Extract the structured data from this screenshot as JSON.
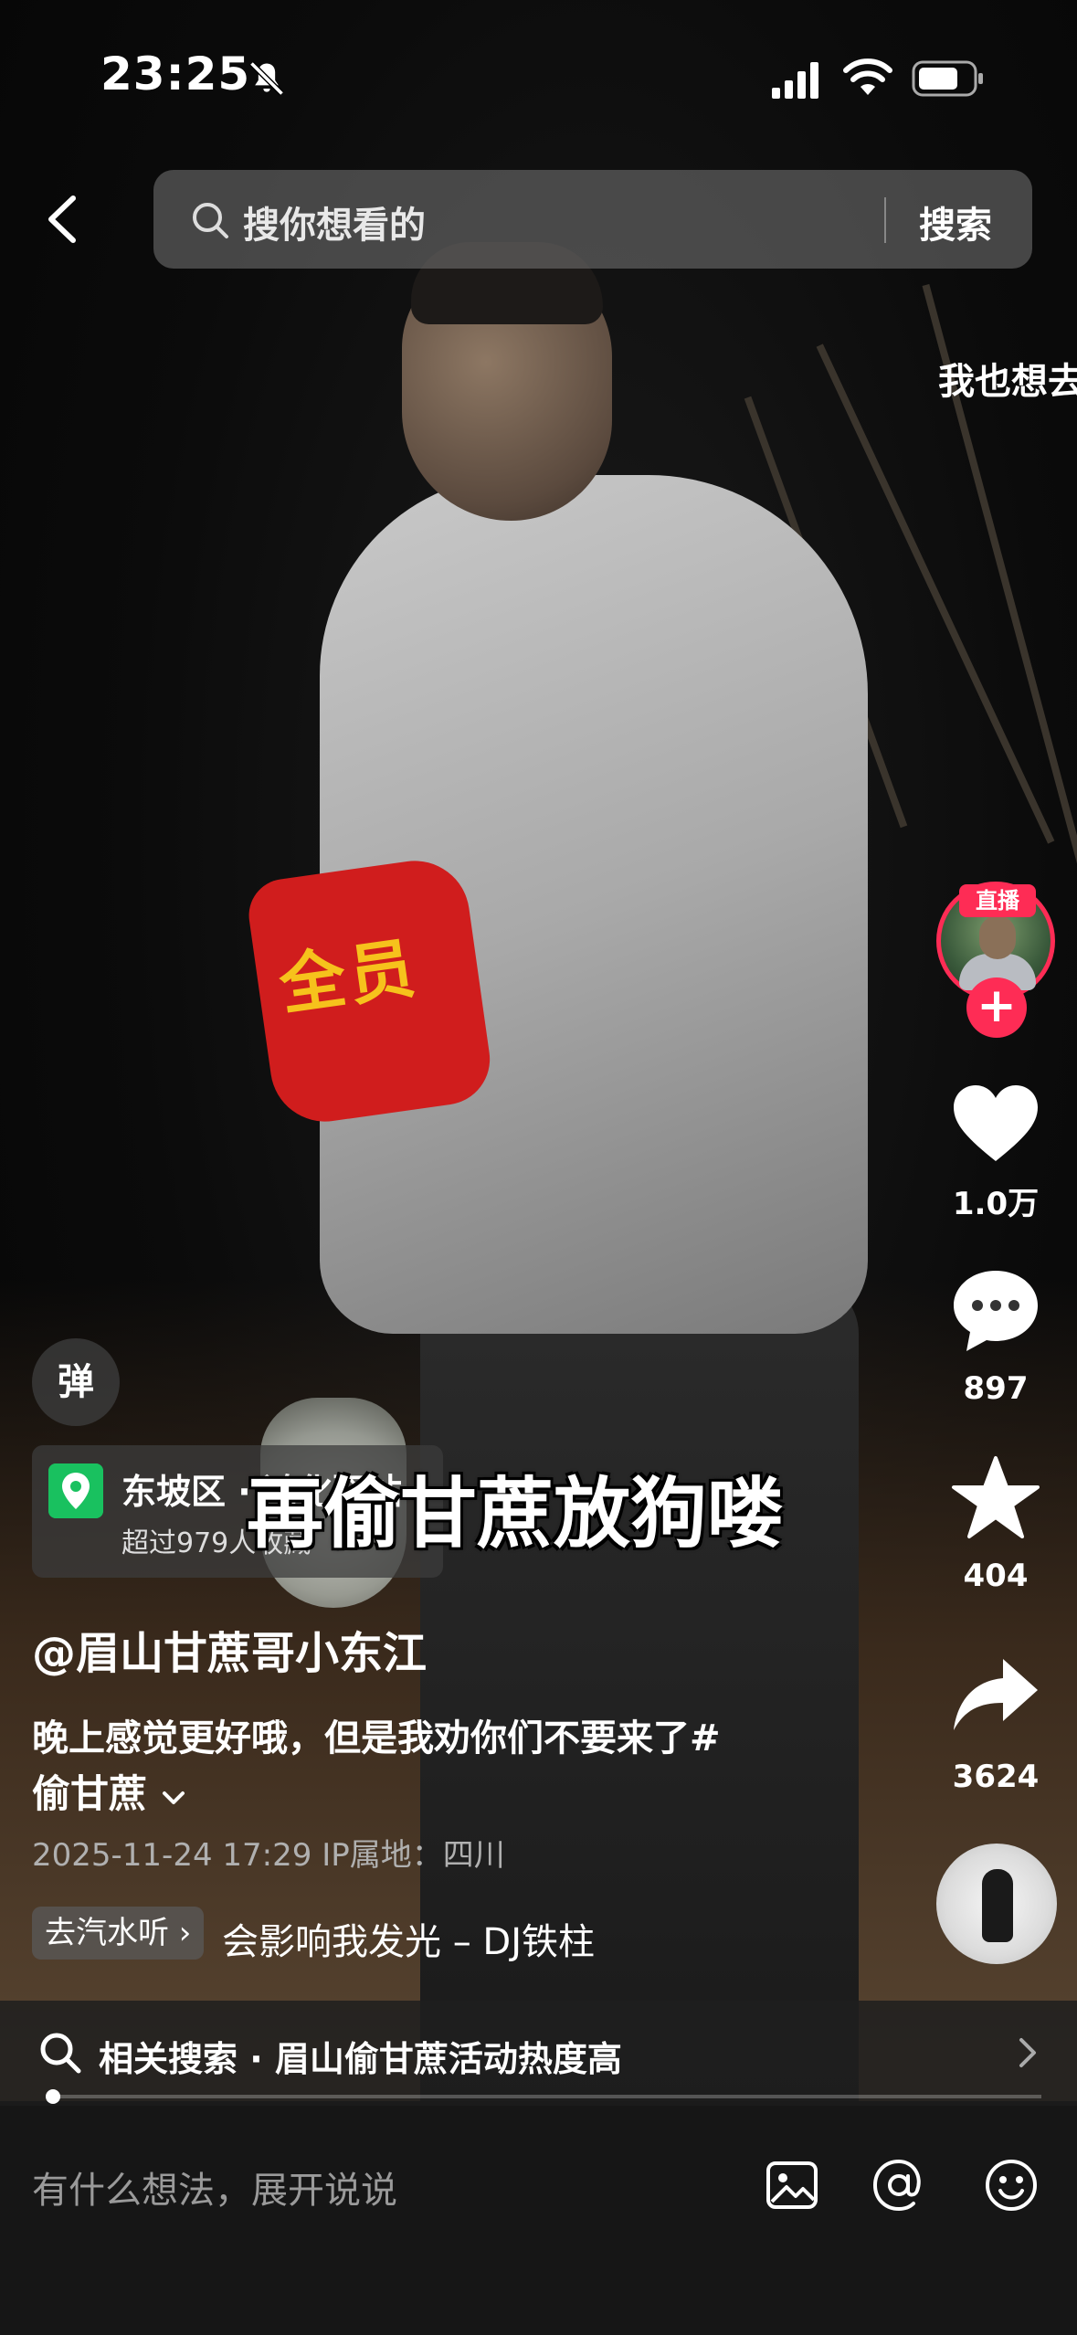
{
  "status_bar": {
    "time": "23:25",
    "icons": [
      "bell-slash-icon",
      "signal-icon",
      "wifi-icon",
      "battery-icon"
    ]
  },
  "top_bar": {
    "back_icon": "chevron-left-icon",
    "search_placeholder": "搜你想看的",
    "search_button": "搜索"
  },
  "danmaku": "我也想去",
  "video": {
    "subtitle": "再偷甘蔗放狗喽",
    "armband_text": "全员"
  },
  "right_rail": {
    "live_badge": "直播",
    "follow_icon": "plus-icon",
    "like_count": "1.0万",
    "comment_count": "897",
    "favorite_count": "404",
    "share_count": "3624"
  },
  "danmu_toggle": "弹",
  "location": {
    "name": "东坡区 · 鸿化驿站",
    "subtitle": "超过979人收藏"
  },
  "author": "@眉山甘蔗哥小东江",
  "description": "晚上感觉更好哦，但是我劝你们不要来了#",
  "hashtag": "偷甘蔗",
  "meta": "2025-11-24 17:29   IP属地：四川",
  "music": {
    "tag": "去汽水听",
    "title": "会影响我发光 – DJ铁柱"
  },
  "related_search": "相关搜索 · 眉山偷甘蔗活动热度高",
  "progress": 0.01,
  "comment_bar": {
    "placeholder": "有什么想法，展开说说",
    "icons": [
      "image-icon",
      "at-icon",
      "emoji-icon"
    ]
  }
}
